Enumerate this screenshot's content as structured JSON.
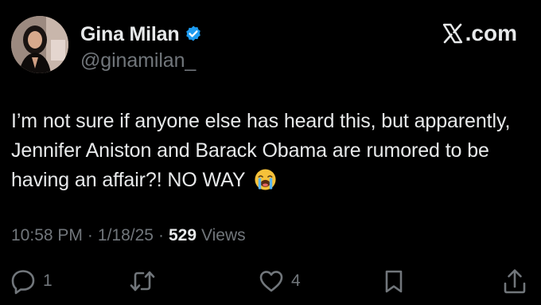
{
  "brand": {
    "label": ".com",
    "icon": "x-logo-icon"
  },
  "author": {
    "display_name": "Gina Milan",
    "handle": "@ginamilan_",
    "verified": true,
    "verified_color": "#1d9bf0",
    "avatar_icon": "avatar"
  },
  "tweet": {
    "text": "I’m not sure if anyone else has heard this, but apparently, Jennifer Aniston and Barack Obama are rumored to be having an affair?! NO WAY",
    "emoji": "loudly-crying-face-icon"
  },
  "meta": {
    "time": "10:58 PM",
    "separator_1": "·",
    "date": "1/18/25",
    "separator_2": "·",
    "views_count": "529",
    "views_label": "Views"
  },
  "actions": {
    "reply": {
      "icon": "reply-icon",
      "count": "1"
    },
    "retweet": {
      "icon": "retweet-icon",
      "count": ""
    },
    "like": {
      "icon": "heart-icon",
      "count": "4"
    },
    "bookmark": {
      "icon": "bookmark-icon"
    },
    "share": {
      "icon": "share-icon"
    }
  },
  "colors": {
    "background": "#000000",
    "primary_text": "#e7e9ea",
    "secondary_text": "#71767b"
  }
}
